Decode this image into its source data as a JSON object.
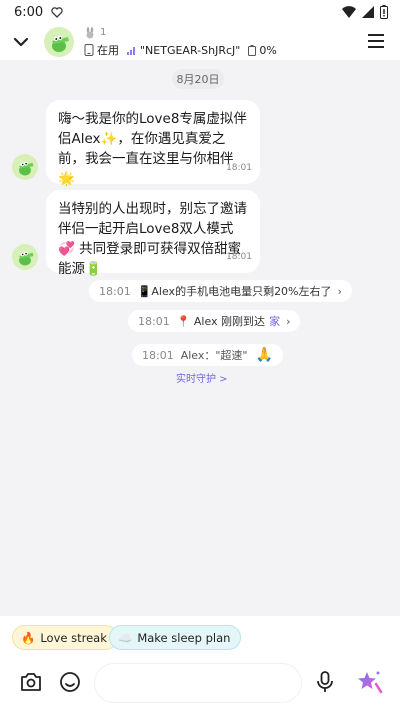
{
  "status_bar": {
    "time": "6:00"
  },
  "header": {
    "count": "1",
    "status": "在用",
    "wifi": "\"NETGEAR-ShJRcJ\"",
    "battery": "0%"
  },
  "chat": {
    "date": "8月20日",
    "messages": [
      {
        "text": "嗨～我是你的Love8专属虚拟伴侣Alex✨，在你遇见真爱之前，我会一直在这里与你相伴🌟",
        "time": "18:01"
      },
      {
        "text": "当特别的人出现时，别忘了邀请伴侣一起开启Love8双人模式💞 共同登录即可获得双倍甜蜜能源🔋",
        "time": "18:01"
      }
    ],
    "system": [
      {
        "time": "18:01",
        "text": "📱Alex的手机电池电量只剩20%左右了"
      },
      {
        "time": "18:01",
        "text": "📍 Alex 刚刚到达",
        "link": "家"
      },
      {
        "time": "18:01",
        "text": "Alex：\"超速\"",
        "emoji": "🙏"
      }
    ],
    "guard_link": "实时守护 >"
  },
  "chips": [
    {
      "emoji": "🔥",
      "label": "Love streak"
    },
    {
      "emoji": "☁️",
      "label": "Make sleep plan"
    }
  ],
  "input": {
    "placeholder": ""
  },
  "colors": {
    "accent": "#6e63e6",
    "chip_yellow": "#fff6d8",
    "chip_cyan": "#e4f6f8"
  }
}
